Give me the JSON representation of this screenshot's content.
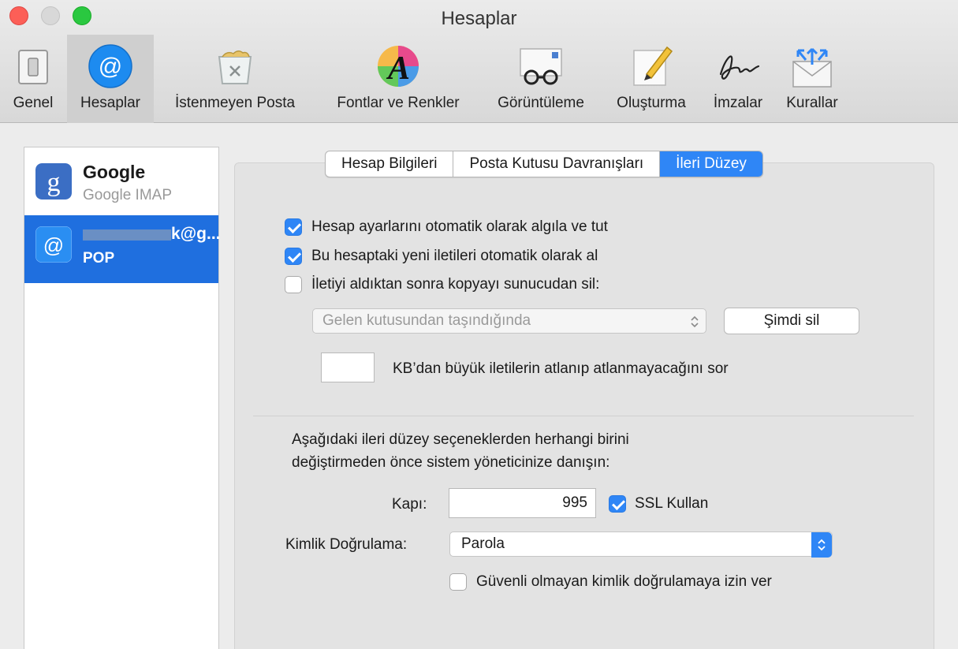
{
  "window": {
    "title": "Hesaplar"
  },
  "toolbar": {
    "items": [
      {
        "label": "Genel",
        "icon": "general-switch-icon"
      },
      {
        "label": "Hesaplar",
        "icon": "at-sign-icon"
      },
      {
        "label": "İstenmeyen Posta",
        "icon": "junk-trash-icon"
      },
      {
        "label": "Fontlar ve Renkler",
        "icon": "fonts-colors-icon"
      },
      {
        "label": "Görüntüleme",
        "icon": "glasses-icon"
      },
      {
        "label": "Oluşturma",
        "icon": "pencil-icon"
      },
      {
        "label": "İmzalar",
        "icon": "signature-icon"
      },
      {
        "label": "Kurallar",
        "icon": "rules-envelope-icon"
      }
    ]
  },
  "sidebar": {
    "accounts": [
      {
        "name": "Google",
        "type": "Google IMAP",
        "icon": "google-icon"
      },
      {
        "name": "k@g...",
        "type": "POP",
        "icon": "at-sign-icon"
      }
    ]
  },
  "tabs": [
    "Hesap Bilgileri",
    "Posta Kutusu Davranışları",
    "İleri Düzey"
  ],
  "options": {
    "auto_detect": {
      "label": "Hesap ayarlarını otomatik olarak algıla ve tut",
      "checked": true
    },
    "auto_fetch": {
      "label": "Bu hesaptaki yeni iletileri otomatik olarak al",
      "checked": true
    },
    "delete_after": {
      "label": "İletiyi aldıktan sonra kopyayı sunucudan sil:",
      "checked": false
    },
    "delete_when": {
      "value": "Gelen kutusundan taşındığında"
    },
    "delete_now": {
      "label": "Şimdi sil"
    },
    "kb_prompt": {
      "value": "",
      "label": "KB’dan büyük iletilerin atlanıp atlanmayacağını sor"
    }
  },
  "advanced": {
    "note_line1": "Aşağıdaki ileri düzey seçeneklerden herhangi birini",
    "note_line2": "değiştirmeden önce sistem yöneticinize danışın:",
    "port_label": "Kapı:",
    "port_value": "995",
    "ssl": {
      "label": "SSL Kullan",
      "checked": true
    },
    "auth_label": "Kimlik Doğrulama:",
    "auth_value": "Parola",
    "insecure": {
      "label": "Güvenli olmayan kimlik doğrulamaya izin ver",
      "checked": false
    }
  },
  "colors": {
    "accent": "#2f86f6",
    "selection": "#1f6fdf"
  }
}
